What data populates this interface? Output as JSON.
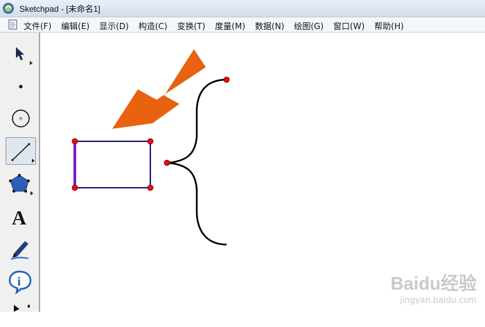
{
  "window": {
    "title": "Sketchpad  - [未命名1]",
    "app_icon": "sketchpad-logo-icon"
  },
  "menubar": {
    "doc_icon": "document-icon",
    "items": [
      {
        "label": "文件(F)"
      },
      {
        "label": "编辑(E)"
      },
      {
        "label": "显示(D)"
      },
      {
        "label": "构造(C)"
      },
      {
        "label": "变换(T)"
      },
      {
        "label": "度量(M)"
      },
      {
        "label": "数据(N)"
      },
      {
        "label": "绘图(G)"
      },
      {
        "label": "窗口(W)"
      },
      {
        "label": "帮助(H)"
      }
    ]
  },
  "toolbox": {
    "tools": [
      {
        "name": "arrow-select-tool",
        "icon": "arrow-icon",
        "selected": false
      },
      {
        "name": "point-tool",
        "icon": "point-icon",
        "selected": false
      },
      {
        "name": "compass-tool",
        "icon": "circle-icon",
        "selected": false
      },
      {
        "name": "straightedge-tool",
        "icon": "segment-icon",
        "selected": true
      },
      {
        "name": "polygon-tool",
        "icon": "pentagon-icon",
        "selected": false
      },
      {
        "name": "text-tool",
        "icon": "text-a-icon",
        "selected": false,
        "glyph": "A"
      },
      {
        "name": "marker-tool",
        "icon": "marker-pen-icon",
        "selected": false
      },
      {
        "name": "information-tool",
        "icon": "info-icon",
        "selected": false
      },
      {
        "name": "custom-tool",
        "icon": "custom-tool-icon",
        "selected": false
      }
    ]
  },
  "canvas": {
    "arrow_color": "#e8620f",
    "rectangle_stroke": "#1a1a7a",
    "point_color": "#e01010",
    "highlight_edge_color": "#a020f0",
    "brace_color": "#000000"
  },
  "watermark": {
    "logo": "Baidu经验",
    "site": "jingyan.baidu.com"
  }
}
